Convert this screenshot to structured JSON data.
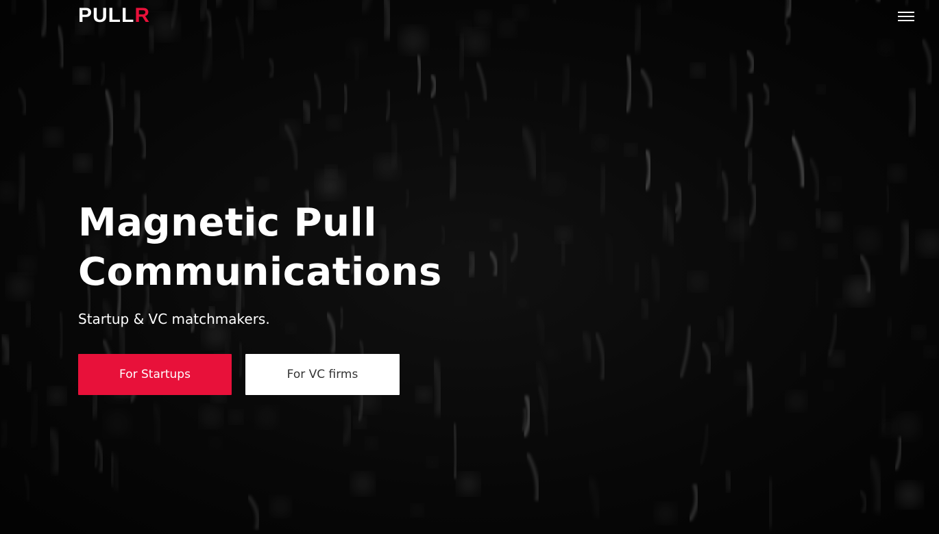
{
  "brand": {
    "logo_main": "PULL",
    "logo_accent": "R",
    "accent_color": "#e8113a"
  },
  "header": {
    "menu_icon": "hamburger-menu-icon"
  },
  "hero": {
    "title_line1": "Magnetic Pull",
    "title_line2": "Communications",
    "subtitle": "Startup & VC matchmakers.",
    "background": "dark-magnetic-particles-image"
  },
  "cta": {
    "startups_label": "For Startups",
    "vc_label": "For VC firms",
    "primary_color": "#e8113a",
    "secondary_color": "#ffffff"
  }
}
